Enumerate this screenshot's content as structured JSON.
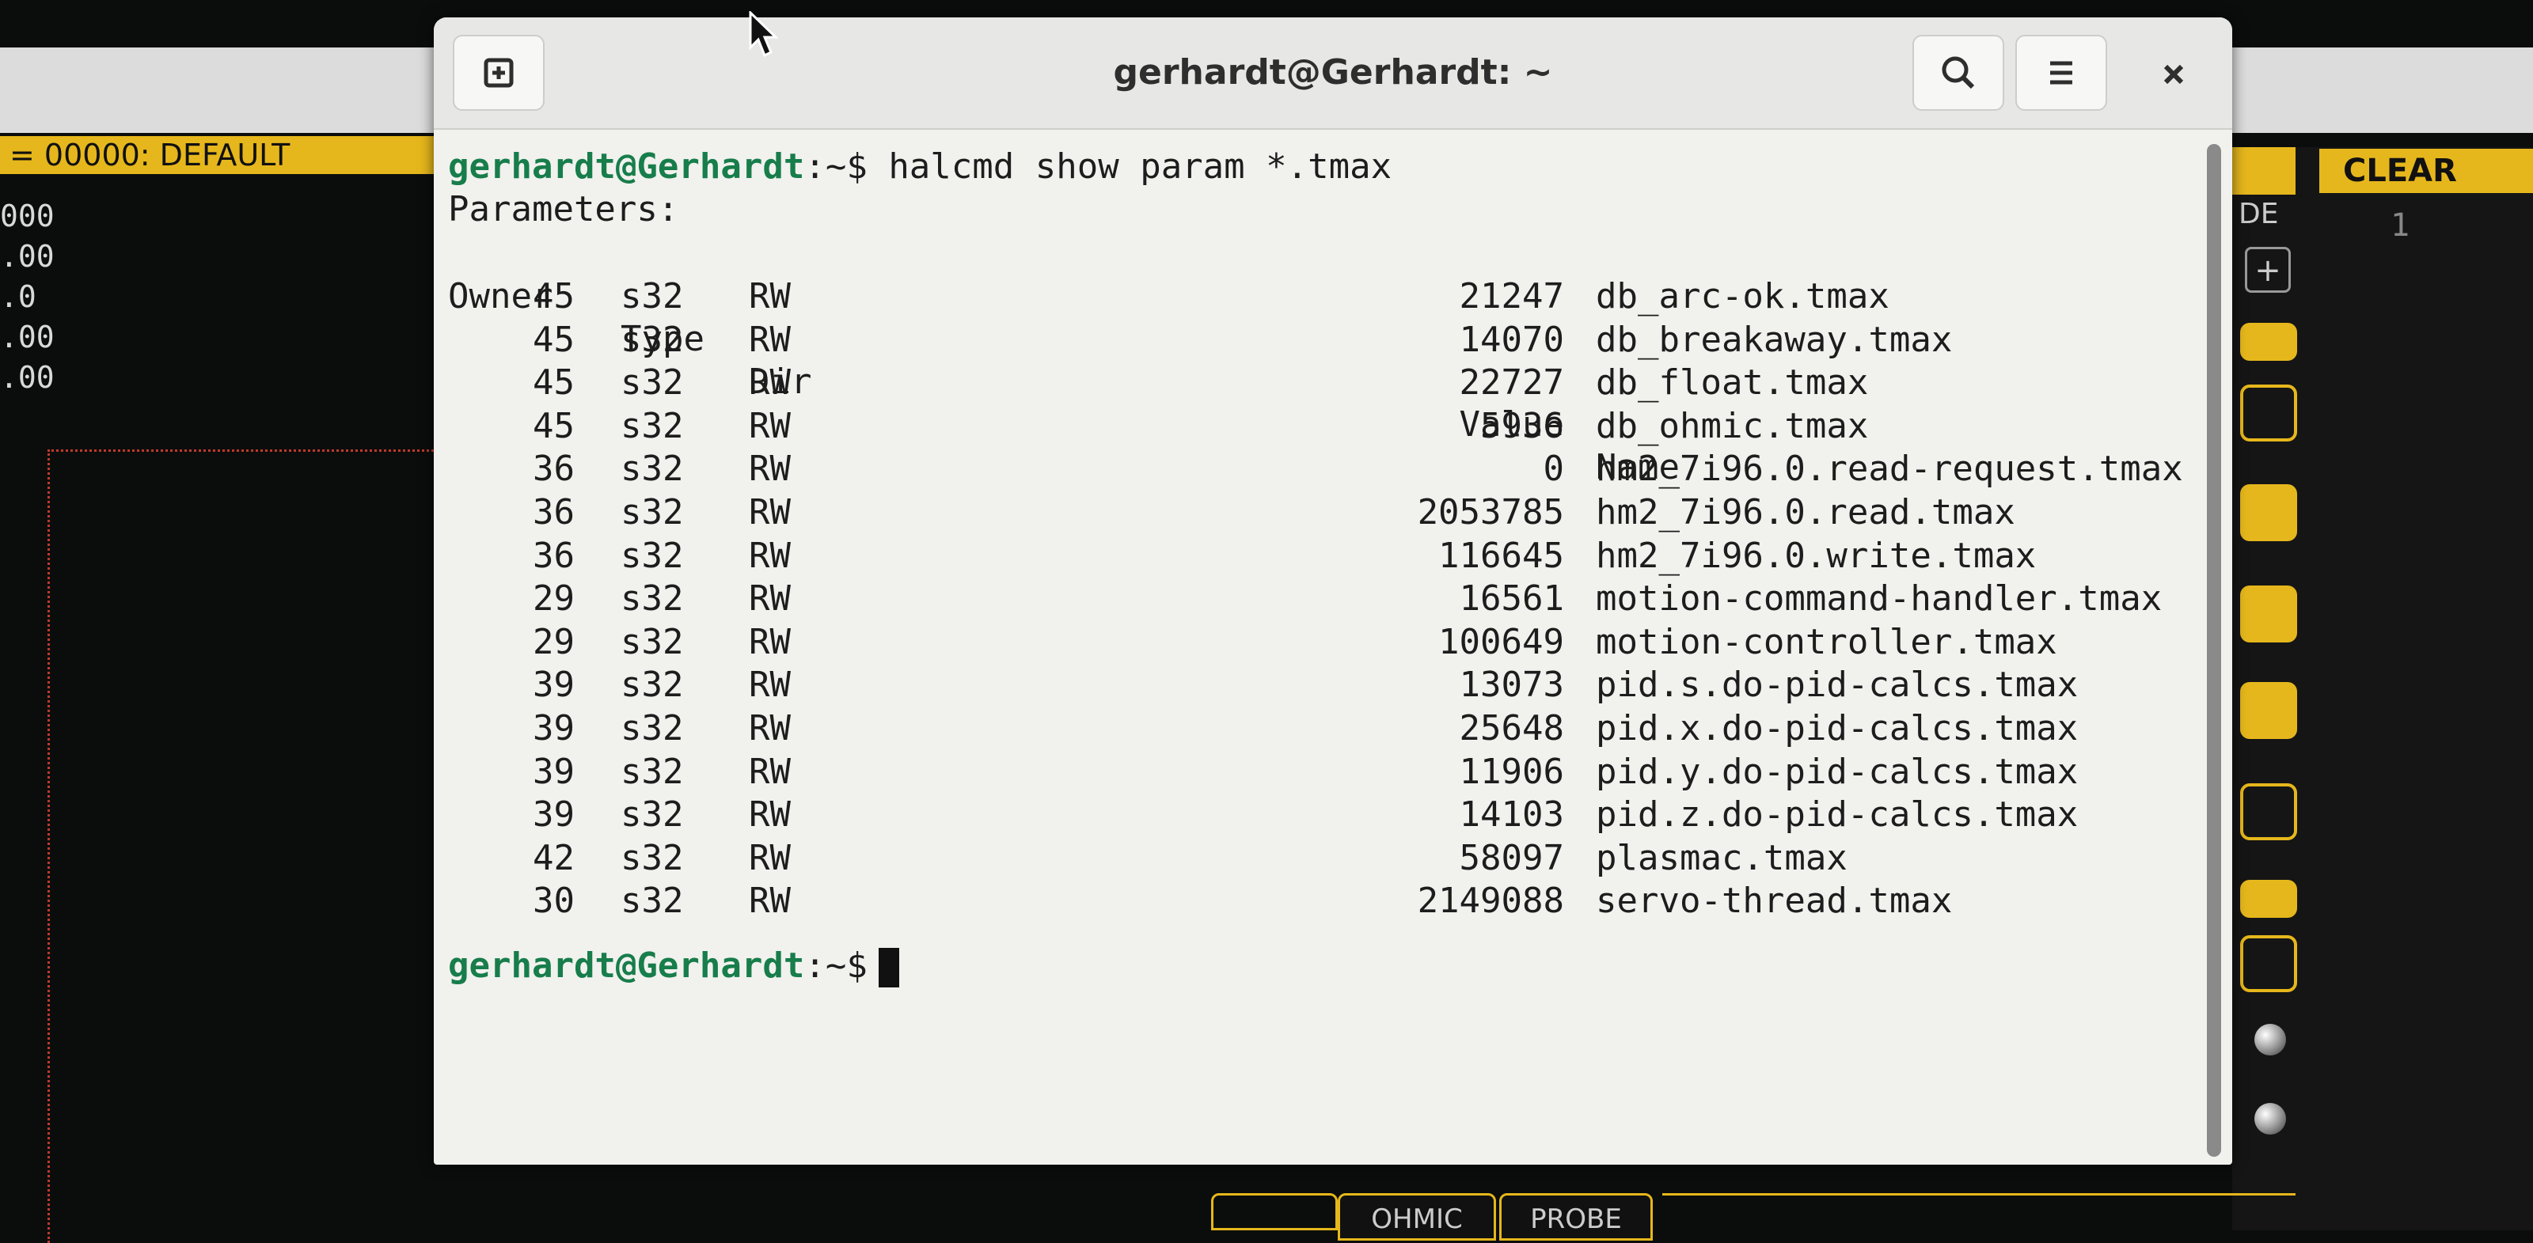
{
  "background_app": {
    "status_label": "= 00000: DEFAULT",
    "dro_values": [
      "000",
      ".00",
      ".0",
      ".00",
      ".00"
    ],
    "clear_button": "CLEAR",
    "side_label": "DE",
    "side_value": "1",
    "plus_label": "+",
    "bottom_tabs": [
      "OHMIC",
      "PROBE"
    ],
    "accent_color": "#e6b71c"
  },
  "terminal": {
    "title": "gerhardt@Gerhardt: ~",
    "new_tab_icon": "new-tab-icon",
    "search_icon": "search-icon",
    "menu_icon": "hamburger-menu-icon",
    "close_icon": "close-icon",
    "prompt_user": "gerhardt@Gerhardt",
    "prompt_path": ":~$",
    "command": " halcmd show param *.tmax",
    "parameters_heading": "Parameters:",
    "columns": {
      "owner": "Owner",
      "type": "Type",
      "dir": "Dir",
      "value": "Value",
      "name": "Name"
    },
    "rows": [
      {
        "owner": "45",
        "type": "s32",
        "dir": "RW",
        "value": "21247",
        "name": "db_arc-ok.tmax"
      },
      {
        "owner": "45",
        "type": "s32",
        "dir": "RW",
        "value": "14070",
        "name": "db_breakaway.tmax"
      },
      {
        "owner": "45",
        "type": "s32",
        "dir": "RW",
        "value": "22727",
        "name": "db_float.tmax"
      },
      {
        "owner": "45",
        "type": "s32",
        "dir": "RW",
        "value": "5936",
        "name": "db_ohmic.tmax"
      },
      {
        "owner": "36",
        "type": "s32",
        "dir": "RW",
        "value": "0",
        "name": "hm2_7i96.0.read-request.tmax"
      },
      {
        "owner": "36",
        "type": "s32",
        "dir": "RW",
        "value": "2053785",
        "name": "hm2_7i96.0.read.tmax"
      },
      {
        "owner": "36",
        "type": "s32",
        "dir": "RW",
        "value": "116645",
        "name": "hm2_7i96.0.write.tmax"
      },
      {
        "owner": "29",
        "type": "s32",
        "dir": "RW",
        "value": "16561",
        "name": "motion-command-handler.tmax"
      },
      {
        "owner": "29",
        "type": "s32",
        "dir": "RW",
        "value": "100649",
        "name": "motion-controller.tmax"
      },
      {
        "owner": "39",
        "type": "s32",
        "dir": "RW",
        "value": "13073",
        "name": "pid.s.do-pid-calcs.tmax"
      },
      {
        "owner": "39",
        "type": "s32",
        "dir": "RW",
        "value": "25648",
        "name": "pid.x.do-pid-calcs.tmax"
      },
      {
        "owner": "39",
        "type": "s32",
        "dir": "RW",
        "value": "11906",
        "name": "pid.y.do-pid-calcs.tmax"
      },
      {
        "owner": "39",
        "type": "s32",
        "dir": "RW",
        "value": "14103",
        "name": "pid.z.do-pid-calcs.tmax"
      },
      {
        "owner": "42",
        "type": "s32",
        "dir": "RW",
        "value": "58097",
        "name": "plasmac.tmax"
      },
      {
        "owner": "30",
        "type": "s32",
        "dir": "RW",
        "value": "2149088",
        "name": "servo-thread.tmax"
      }
    ],
    "colors": {
      "prompt_user": "#177d4a",
      "background": "#f1f1ee"
    }
  }
}
